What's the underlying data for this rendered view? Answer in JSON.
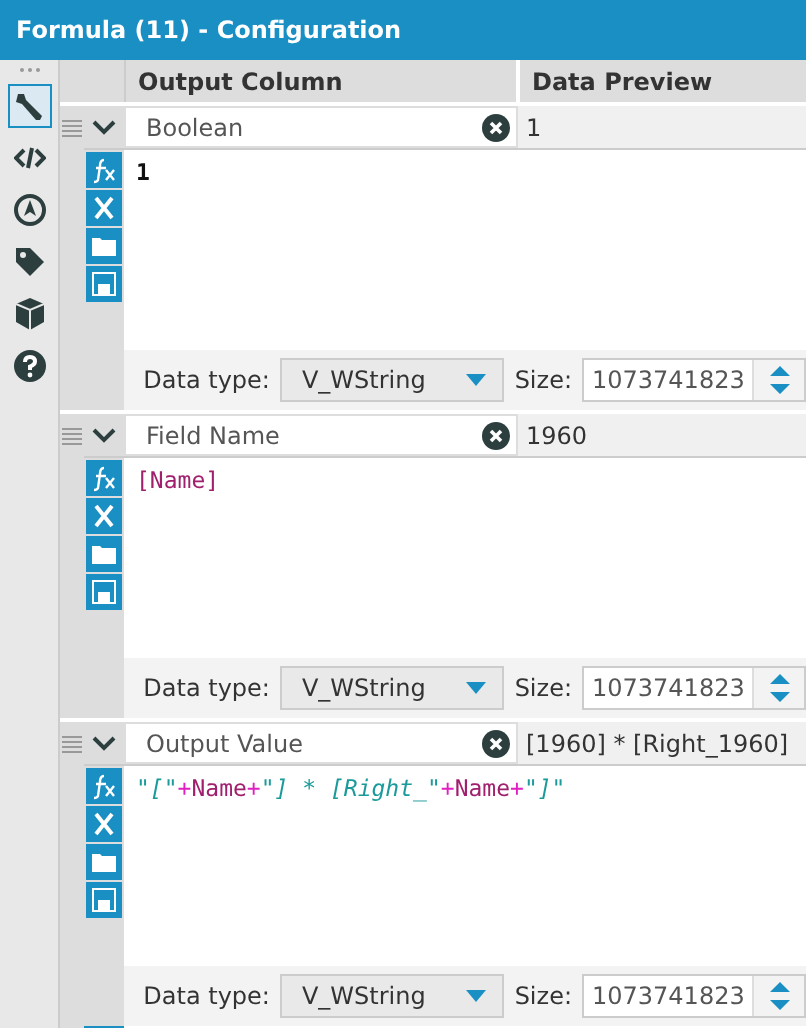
{
  "window": {
    "title": "Formula (11) - Configuration"
  },
  "toolbar": [
    {
      "kind": "wrench",
      "selected": true
    },
    {
      "kind": "code",
      "selected": false
    },
    {
      "kind": "target",
      "selected": false
    },
    {
      "kind": "tag",
      "selected": false
    },
    {
      "kind": "box",
      "selected": false
    },
    {
      "kind": "help",
      "selected": false
    }
  ],
  "columns": [
    "Output Column",
    "Data Preview"
  ],
  "formulas": [
    {
      "field": "Boolean",
      "preview": "1",
      "expression": [
        {
          "kind": "number",
          "text": "1"
        }
      ],
      "data_type_label": "Data type:",
      "data_type": "V_WString",
      "size_label": "Size:",
      "size": "1073741823"
    },
    {
      "field": "Field Name",
      "preview": "1960",
      "expression": [
        {
          "kind": "field",
          "text": "[Name]"
        }
      ],
      "data_type_label": "Data type:",
      "data_type": "V_WString",
      "size_label": "Size:",
      "size": "1073741823"
    },
    {
      "field": "Output Value",
      "preview": "[1960] * [Right_1960]",
      "expression": [
        {
          "kind": "string",
          "text": "\"[\""
        },
        {
          "kind": "operator",
          "text": "+"
        },
        {
          "kind": "field",
          "text": "Name"
        },
        {
          "kind": "operator",
          "text": "+"
        },
        {
          "kind": "string",
          "text": "\"] * [Right_\""
        },
        {
          "kind": "operator",
          "text": "+"
        },
        {
          "kind": "field",
          "text": "Name"
        },
        {
          "kind": "operator",
          "text": "+"
        },
        {
          "kind": "string",
          "text": "\"]\""
        }
      ],
      "data_type_label": "Data type:",
      "data_type": "V_WString",
      "size_label": "Size:",
      "size": "1073741823"
    }
  ]
}
